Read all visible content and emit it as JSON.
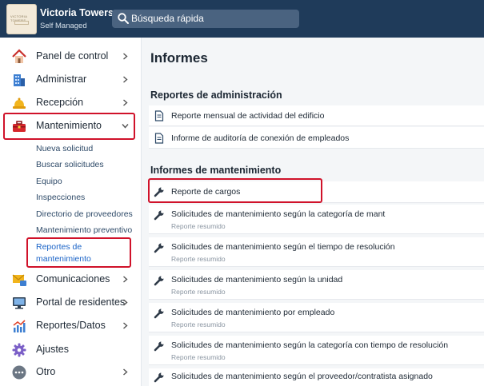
{
  "header": {
    "logo_text": "VICTORIA TOWERS",
    "org_name": "Victoria Towers",
    "org_sub": "Self Managed",
    "search_label": "Búsqueda rápida"
  },
  "sidebar": {
    "items": [
      {
        "label": "Panel de control",
        "icon": "house-icon"
      },
      {
        "label": "Administrar",
        "icon": "building-icon"
      },
      {
        "label": "Recepción",
        "icon": "bell-icon"
      },
      {
        "label": "Mantenimiento",
        "icon": "toolbox-icon"
      },
      {
        "label": "Comunicaciones",
        "icon": "mail-icon"
      },
      {
        "label": "Portal de residentes",
        "icon": "monitor-icon"
      },
      {
        "label": "Reportes/Datos",
        "icon": "chart-icon"
      },
      {
        "label": "Ajustes",
        "icon": "gear-icon"
      },
      {
        "label": "Otro",
        "icon": "more-icon"
      }
    ],
    "sub_items": [
      {
        "label": "Nueva solicitud"
      },
      {
        "label": "Buscar solicitudes"
      },
      {
        "label": "Equipo"
      },
      {
        "label": "Inspecciones"
      },
      {
        "label": "Directorio de proveedores"
      },
      {
        "label": "Mantenimiento preventivo"
      },
      {
        "label_line1": "Reportes de",
        "label_line2": "mantenimiento"
      }
    ]
  },
  "main": {
    "title": "Informes",
    "sections": [
      {
        "title": "Reportes de administración",
        "rows": [
          {
            "title": "Reporte mensual de actividad del edificio",
            "icon": "document-icon"
          },
          {
            "title": "Informe de auditoría de conexión de empleados",
            "icon": "document-icon"
          }
        ]
      },
      {
        "title": "Informes de mantenimiento",
        "rows": [
          {
            "title": "Reporte de cargos",
            "subtitle": "",
            "icon": "wrench-icon"
          },
          {
            "title": "Solicitudes de mantenimiento según la categoría de mant",
            "subtitle": "Reporte resumido",
            "icon": "wrench-icon"
          },
          {
            "title": "Solicitudes de mantenimiento según el tiempo de resolución",
            "subtitle": "Reporte resumido",
            "icon": "wrench-icon"
          },
          {
            "title": "Solicitudes de mantenimiento según la unidad",
            "subtitle": "Reporte resumido",
            "icon": "wrench-icon"
          },
          {
            "title": "Solicitudes de mantenimiento por empleado",
            "subtitle": "Reporte resumido",
            "icon": "wrench-icon"
          },
          {
            "title": "Solicitudes de mantenimiento según la categoría con tiempo de resolución",
            "subtitle": "Reporte resumido",
            "icon": "wrench-icon"
          },
          {
            "title": "Solicitudes de mantenimiento según el proveedor/contratista asignado",
            "subtitle": "",
            "icon": "wrench-icon"
          }
        ]
      }
    ]
  },
  "colors": {
    "topbar": "#1f3b5a",
    "highlight": "#d0122a",
    "link": "#2e4a68"
  }
}
